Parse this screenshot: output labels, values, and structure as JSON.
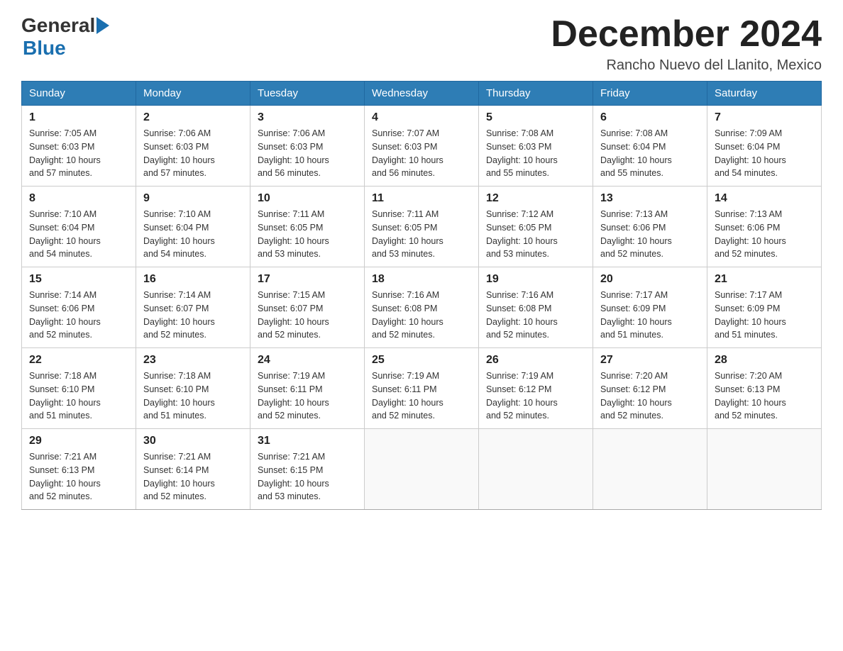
{
  "header": {
    "logo_general": "General",
    "logo_blue": "Blue",
    "month_title": "December 2024",
    "subtitle": "Rancho Nuevo del Llanito, Mexico"
  },
  "weekdays": [
    "Sunday",
    "Monday",
    "Tuesday",
    "Wednesday",
    "Thursday",
    "Friday",
    "Saturday"
  ],
  "weeks": [
    [
      {
        "day": "1",
        "sunrise": "7:05 AM",
        "sunset": "6:03 PM",
        "daylight": "10 hours and 57 minutes."
      },
      {
        "day": "2",
        "sunrise": "7:06 AM",
        "sunset": "6:03 PM",
        "daylight": "10 hours and 57 minutes."
      },
      {
        "day": "3",
        "sunrise": "7:06 AM",
        "sunset": "6:03 PM",
        "daylight": "10 hours and 56 minutes."
      },
      {
        "day": "4",
        "sunrise": "7:07 AM",
        "sunset": "6:03 PM",
        "daylight": "10 hours and 56 minutes."
      },
      {
        "day": "5",
        "sunrise": "7:08 AM",
        "sunset": "6:03 PM",
        "daylight": "10 hours and 55 minutes."
      },
      {
        "day": "6",
        "sunrise": "7:08 AM",
        "sunset": "6:04 PM",
        "daylight": "10 hours and 55 minutes."
      },
      {
        "day": "7",
        "sunrise": "7:09 AM",
        "sunset": "6:04 PM",
        "daylight": "10 hours and 54 minutes."
      }
    ],
    [
      {
        "day": "8",
        "sunrise": "7:10 AM",
        "sunset": "6:04 PM",
        "daylight": "10 hours and 54 minutes."
      },
      {
        "day": "9",
        "sunrise": "7:10 AM",
        "sunset": "6:04 PM",
        "daylight": "10 hours and 54 minutes."
      },
      {
        "day": "10",
        "sunrise": "7:11 AM",
        "sunset": "6:05 PM",
        "daylight": "10 hours and 53 minutes."
      },
      {
        "day": "11",
        "sunrise": "7:11 AM",
        "sunset": "6:05 PM",
        "daylight": "10 hours and 53 minutes."
      },
      {
        "day": "12",
        "sunrise": "7:12 AM",
        "sunset": "6:05 PM",
        "daylight": "10 hours and 53 minutes."
      },
      {
        "day": "13",
        "sunrise": "7:13 AM",
        "sunset": "6:06 PM",
        "daylight": "10 hours and 52 minutes."
      },
      {
        "day": "14",
        "sunrise": "7:13 AM",
        "sunset": "6:06 PM",
        "daylight": "10 hours and 52 minutes."
      }
    ],
    [
      {
        "day": "15",
        "sunrise": "7:14 AM",
        "sunset": "6:06 PM",
        "daylight": "10 hours and 52 minutes."
      },
      {
        "day": "16",
        "sunrise": "7:14 AM",
        "sunset": "6:07 PM",
        "daylight": "10 hours and 52 minutes."
      },
      {
        "day": "17",
        "sunrise": "7:15 AM",
        "sunset": "6:07 PM",
        "daylight": "10 hours and 52 minutes."
      },
      {
        "day": "18",
        "sunrise": "7:16 AM",
        "sunset": "6:08 PM",
        "daylight": "10 hours and 52 minutes."
      },
      {
        "day": "19",
        "sunrise": "7:16 AM",
        "sunset": "6:08 PM",
        "daylight": "10 hours and 52 minutes."
      },
      {
        "day": "20",
        "sunrise": "7:17 AM",
        "sunset": "6:09 PM",
        "daylight": "10 hours and 51 minutes."
      },
      {
        "day": "21",
        "sunrise": "7:17 AM",
        "sunset": "6:09 PM",
        "daylight": "10 hours and 51 minutes."
      }
    ],
    [
      {
        "day": "22",
        "sunrise": "7:18 AM",
        "sunset": "6:10 PM",
        "daylight": "10 hours and 51 minutes."
      },
      {
        "day": "23",
        "sunrise": "7:18 AM",
        "sunset": "6:10 PM",
        "daylight": "10 hours and 51 minutes."
      },
      {
        "day": "24",
        "sunrise": "7:19 AM",
        "sunset": "6:11 PM",
        "daylight": "10 hours and 52 minutes."
      },
      {
        "day": "25",
        "sunrise": "7:19 AM",
        "sunset": "6:11 PM",
        "daylight": "10 hours and 52 minutes."
      },
      {
        "day": "26",
        "sunrise": "7:19 AM",
        "sunset": "6:12 PM",
        "daylight": "10 hours and 52 minutes."
      },
      {
        "day": "27",
        "sunrise": "7:20 AM",
        "sunset": "6:12 PM",
        "daylight": "10 hours and 52 minutes."
      },
      {
        "day": "28",
        "sunrise": "7:20 AM",
        "sunset": "6:13 PM",
        "daylight": "10 hours and 52 minutes."
      }
    ],
    [
      {
        "day": "29",
        "sunrise": "7:21 AM",
        "sunset": "6:13 PM",
        "daylight": "10 hours and 52 minutes."
      },
      {
        "day": "30",
        "sunrise": "7:21 AM",
        "sunset": "6:14 PM",
        "daylight": "10 hours and 52 minutes."
      },
      {
        "day": "31",
        "sunrise": "7:21 AM",
        "sunset": "6:15 PM",
        "daylight": "10 hours and 53 minutes."
      },
      null,
      null,
      null,
      null
    ]
  ],
  "labels": {
    "sunrise": "Sunrise:",
    "sunset": "Sunset:",
    "daylight": "Daylight:"
  }
}
